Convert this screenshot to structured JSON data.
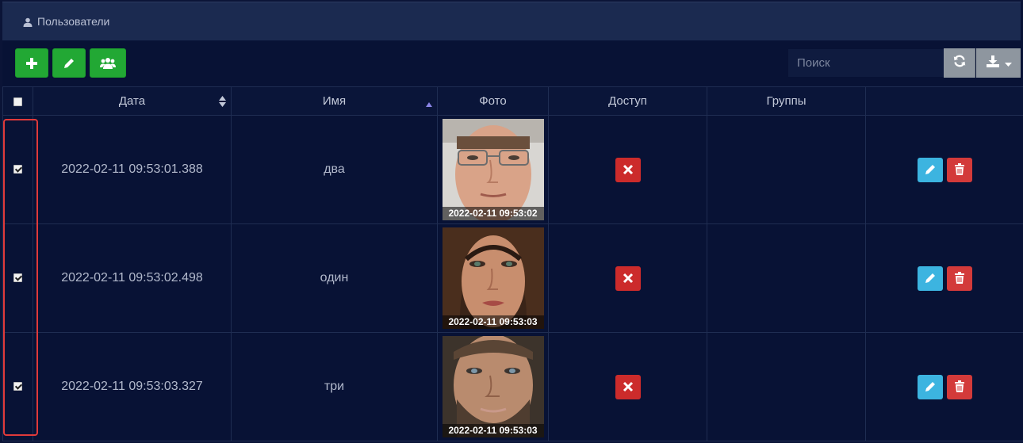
{
  "header": {
    "title": "Пользователи"
  },
  "toolbar": {
    "add_icon": "plus-icon",
    "edit_icon": "pencil-icon",
    "groups_icon": "users-icon",
    "search_placeholder": "Поиск",
    "refresh_icon": "refresh-icon",
    "export_icon": "download-icon"
  },
  "table": {
    "columns": [
      "Дата",
      "Имя",
      "Фото",
      "Доступ",
      "Группы"
    ],
    "rows": [
      {
        "checked": true,
        "date": "2022-02-11 09:53:01.388",
        "name": "два",
        "photo_stamp": "2022-02-11 09:53:02",
        "access": "denied",
        "groups": ""
      },
      {
        "checked": true,
        "date": "2022-02-11 09:53:02.498",
        "name": "один",
        "photo_stamp": "2022-02-11 09:53:03",
        "access": "denied",
        "groups": ""
      },
      {
        "checked": true,
        "date": "2022-02-11 09:53:03.327",
        "name": "три",
        "photo_stamp": "2022-02-11 09:53:03",
        "access": "denied",
        "groups": ""
      }
    ]
  },
  "colors": {
    "background": "#081235",
    "header": "#1b2a50",
    "green": "#22a834",
    "red": "#cc2b2b",
    "blue": "#3cb4e0",
    "gray": "#8e969f",
    "selection": "#e03a3a"
  }
}
